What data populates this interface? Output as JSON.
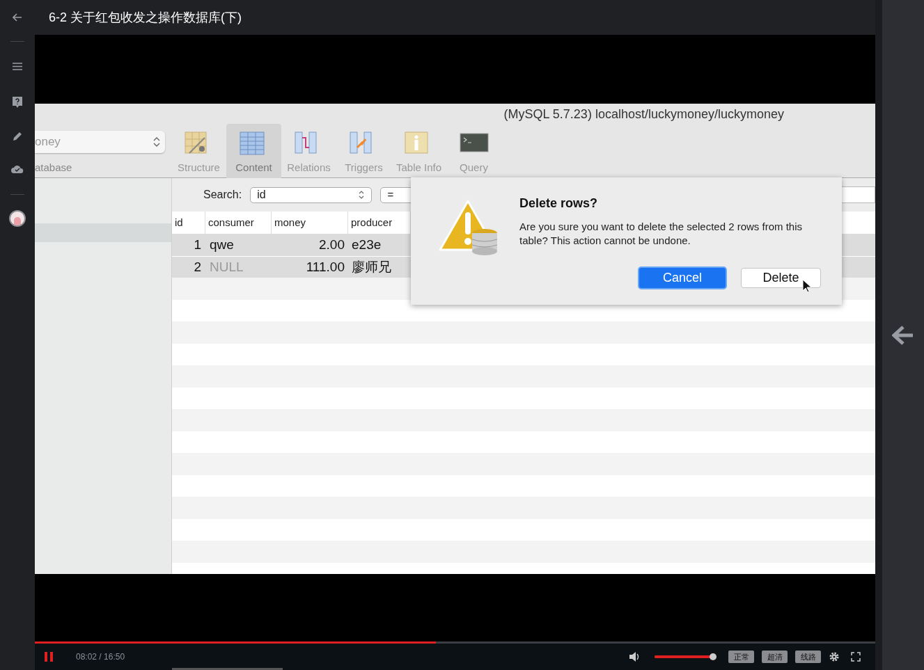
{
  "window": {
    "title": "6-2 关于红包收发之操作数据库(下)"
  },
  "video": {
    "app": {
      "title": "(MySQL 5.7.23) localhost/luckymoney/luckymoney",
      "database_popup": "oney",
      "database_label": "atabase",
      "toolbar": [
        {
          "kind": "structure",
          "label": "Structure",
          "selected": false
        },
        {
          "kind": "content",
          "label": "Content",
          "selected": true
        },
        {
          "kind": "relations",
          "label": "Relations",
          "selected": false
        },
        {
          "kind": "triggers",
          "label": "Triggers",
          "selected": false
        },
        {
          "kind": "info",
          "label": "Table Info",
          "selected": false
        },
        {
          "kind": "query",
          "label": "Query",
          "selected": false
        }
      ],
      "search": {
        "label": "Search:",
        "field": "id",
        "operator": "="
      },
      "table": {
        "columns": [
          "id",
          "consumer",
          "money",
          "producer"
        ],
        "rows": [
          {
            "selected": true,
            "cells": [
              {
                "text": "1",
                "is_null": false
              },
              {
                "text": "qwe",
                "is_null": false
              },
              {
                "text": "2.00",
                "is_null": false
              },
              {
                "text": "e23e",
                "is_null": false
              }
            ]
          },
          {
            "selected": true,
            "cells": [
              {
                "text": "2",
                "is_null": false
              },
              {
                "text": "NULL",
                "is_null": true
              },
              {
                "text": "111.00",
                "is_null": false
              },
              {
                "text": "廖师兄",
                "is_null": false
              }
            ]
          }
        ]
      },
      "dialog": {
        "title": "Delete rows?",
        "message": "Are you sure you want to delete the selected 2 rows from this table? This action cannot be undone.",
        "buttons": [
          {
            "label": "Cancel",
            "default": true
          },
          {
            "label": "Delete",
            "default": false
          }
        ]
      }
    }
  },
  "player": {
    "progress": {
      "level": 0.477
    },
    "playing": true,
    "time": "08:02 / 16:50",
    "volume": {
      "level": 1
    },
    "quality_buttons": [
      "正常",
      "超清",
      "线路"
    ]
  }
}
